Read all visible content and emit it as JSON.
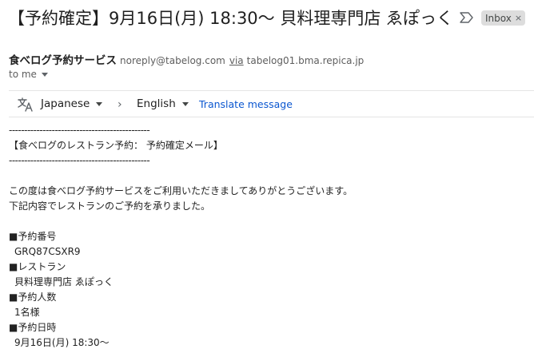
{
  "subject": "【予約確定】9月16日(月) 18:30〜 貝料理専門店 ゑぽっく",
  "labels": {
    "inbox": "Inbox",
    "inbox_remove": "×"
  },
  "sender": {
    "name": "食べログ予約サービス",
    "email": "noreply@tabelog.com",
    "via_label": "via",
    "via_domain": "tabelog01.bma.repica.jp"
  },
  "recipient": {
    "label": "to me"
  },
  "translate_bar": {
    "from_language": "Japanese",
    "arrow": "›",
    "to_language": "English",
    "link_label": "Translate message"
  },
  "body": {
    "separator_top": "----------------------------------------------",
    "heading": "【食べログのレストラン予約： 予約確定メール】",
    "separator_bottom": "----------------------------------------------",
    "greeting_1": "この度は食べログ予約サービスをご利用いただきましてありがとうございます。",
    "greeting_2": "下記内容でレストランのご予約を承りました。",
    "fields": [
      {
        "label": "■予約番号",
        "value": "GRQ87CSXR9"
      },
      {
        "label": "■レストラン",
        "value": "貝料理専門店 ゑぽっく"
      },
      {
        "label": "■予約人数",
        "value": "1名様"
      },
      {
        "label": "■予約日時",
        "value": "9月16日(月) 18:30〜"
      }
    ]
  },
  "icons": {
    "important": "important-marker-icon",
    "translate": "translate-icon",
    "dropdown": "chevron-down-icon"
  }
}
